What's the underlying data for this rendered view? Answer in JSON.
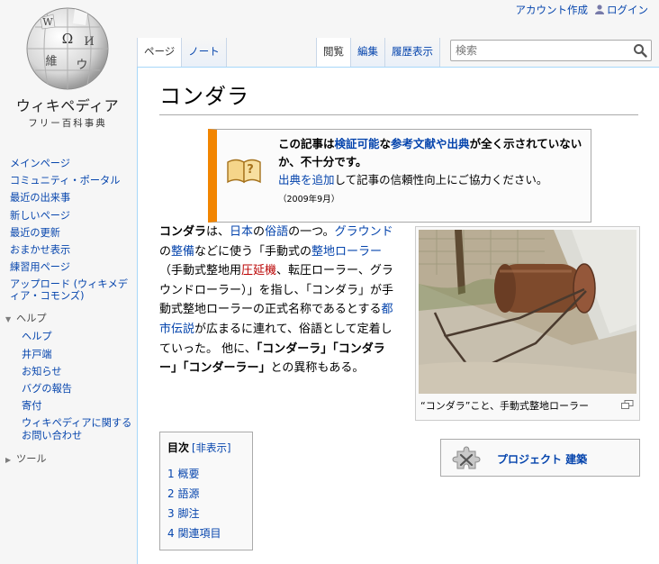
{
  "personal": {
    "create_account": "アカウント作成",
    "login": "ログイン"
  },
  "logo": {
    "wordmark": "ウィキペディア",
    "tagline": "フリー百科事典",
    "globe_glyphs": [
      "W",
      "Ω",
      "И",
      "維",
      "ウ"
    ]
  },
  "sidebar": {
    "nav": [
      "メインページ",
      "コミュニティ・ポータル",
      "最近の出来事",
      "新しいページ",
      "最近の更新",
      "おまかせ表示",
      "練習用ページ",
      "アップロード (ウィキメディア・コモンズ)"
    ],
    "help_heading": "ヘルプ",
    "help_items": [
      "ヘルプ",
      "井戸端",
      "お知らせ",
      "バグの報告",
      "寄付",
      "ウィキペディアに関するお問い合わせ"
    ],
    "tools_heading": "ツール"
  },
  "tabs": {
    "left": [
      "ページ",
      "ノート"
    ],
    "right": [
      "閲覧",
      "編集",
      "履歴表示"
    ]
  },
  "search": {
    "placeholder": "検索"
  },
  "article": {
    "title": "コンダラ",
    "ambox": {
      "line1_a": "この記事は",
      "link_verifiable": "検証可能",
      "line1_b": "な",
      "link_refs": "参考文献や出典",
      "line1_c": "が全く示されていないか、不十分です。",
      "link_add": "出典を追加",
      "line2": "して記事の信頼性向上にご協力ください。",
      "date": "（2009年9月）"
    },
    "lead": {
      "term": "コンダラ",
      "t1": "は、",
      "l_japan": "日本",
      "t2": "の",
      "l_zokugo": "俗語",
      "t3": "の一つ。",
      "l_ground": "グラウンド",
      "t4": "の",
      "l_seibi": "整備",
      "t5": "などに使う「手動式の",
      "l_roller": "整地ローラー",
      "t6": "（手動式整地用",
      "l_rolling": "圧延機",
      "t7": "、転圧ローラー、グラウンドローラー）」を指し、「コンダラ」が手動式整地ローラーの正式名称であるとする",
      "l_legend": "都市伝説",
      "t8": "が広まるに連れて、俗語として定着していった。 他に、",
      "alt1": "「コンダーラ」",
      "alt2": "「コンダラー」",
      "alt3": "「コンダーラー」",
      "t9": "との異称もある。"
    },
    "thumb_caption": "“コンダラ”こと、手動式整地ローラー",
    "toc": {
      "title": "目次",
      "toggle": "[非表示]",
      "items": [
        {
          "num": "1",
          "label": "概要"
        },
        {
          "num": "2",
          "label": "語源"
        },
        {
          "num": "3",
          "label": "脚注"
        },
        {
          "num": "4",
          "label": "関連項目"
        }
      ]
    },
    "project_box": "プロジェクト 建築"
  },
  "colors": {
    "link": "#0645ad",
    "redlink": "#ba0000",
    "ambox_accent": "#f28500",
    "border_blue": "#a7d7f9"
  }
}
